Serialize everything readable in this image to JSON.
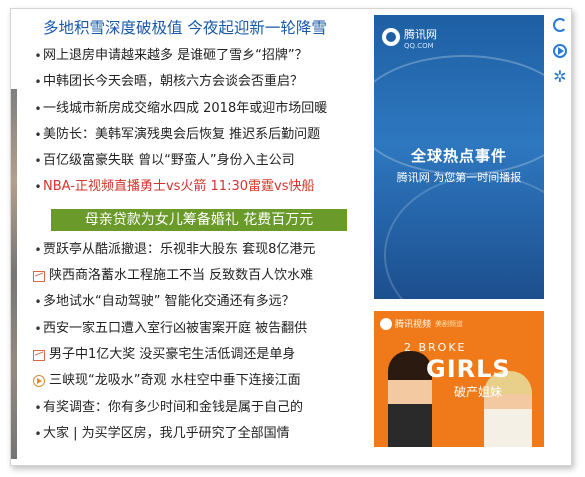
{
  "headline": "多地积雪深度破极值 今夜起迎新一轮降雪",
  "news_group_1": [
    {
      "icon": "bullet",
      "text": "网上退房申请越来越多 是谁砸了雪乡“招牌”？"
    },
    {
      "icon": "bullet",
      "text": "中韩团长今天会晤，朝核六方会谈会否重启？"
    },
    {
      "icon": "bullet",
      "text": "一线城市新房成交缩水四成 2018年或迎市场回暖"
    },
    {
      "icon": "bullet",
      "text": "美防长：美韩军演残奥会后恢复 推迟系后勤问题"
    },
    {
      "icon": "bullet",
      "text": "百亿级富豪失联 曾以“野蛮人”身份入主公司"
    },
    {
      "icon": "bullet",
      "text": "NBA-正视频直播勇士vs火箭 11:30雷霆vs快船",
      "highlight": true
    }
  ],
  "banner": "母亲贷款为女儿筹备婚礼 花费百万元",
  "news_group_2": [
    {
      "icon": "bullet",
      "text": "贾跃亭从酷派撤退：乐视非大股东 套现8亿港元"
    },
    {
      "icon": "image-icon",
      "text": "陕西商洛蓄水工程施工不当 反致数百人饮水难"
    },
    {
      "icon": "bullet",
      "text": "多地试水“自动驾驶” 智能化交通还有多远？"
    },
    {
      "icon": "bullet",
      "text": "西安一家五口遭入室行凶被害案开庭 被告翻供"
    },
    {
      "icon": "image-icon",
      "text": "男子中1亿大奖 没买豪宅生活低调还是单身"
    },
    {
      "icon": "video-icon",
      "text": "三峡现“龙吸水”奇观 水柱空中垂下连接江面"
    },
    {
      "icon": "bullet",
      "text": "有奖调查：你有多少时间和金钱是属于自己的"
    },
    {
      "icon": "bullet",
      "text": "大家 | 为买学区房，我几乎研究了全部国情"
    }
  ],
  "ad_top": {
    "logo_text": "腾讯网",
    "logo_sub": "QQ.COM",
    "title": "全球热点事件",
    "subtitle_brand": "腾讯网",
    "subtitle_rest": "为您第一时间播报"
  },
  "ad_bottom": {
    "logo_text": "腾讯视频",
    "logo_tag": "美剧频道",
    "show_line1": "2 BROKE",
    "show_line2": "GIRLS",
    "show_cn": "破产姐妹"
  },
  "side_icons": [
    "refresh-icon",
    "play-icon",
    "gear-icon"
  ],
  "colors": {
    "headline": "#1a5aa8",
    "highlight": "#d2342b",
    "banner_bg": "#6a9a2a",
    "side_icon": "#2a7ad8",
    "ad_top_bg": "#1e5fa3",
    "ad_bottom_bg": "#f07a1a"
  }
}
